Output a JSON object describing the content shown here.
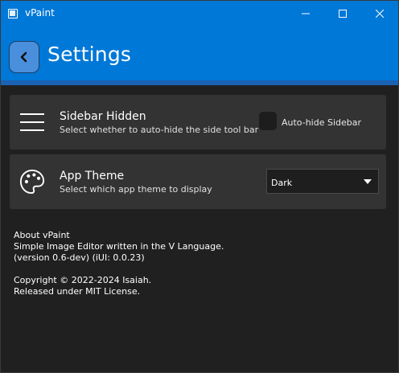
{
  "window": {
    "title": "vPaint"
  },
  "header": {
    "title": "Settings"
  },
  "settings": [
    {
      "title": "Sidebar Hidden",
      "description": "Select whether to auto-hide the side tool bar",
      "control_label": "Auto-hide Sidebar",
      "checked": false
    },
    {
      "title": "App Theme",
      "description": "Select which app theme to display",
      "selected": "Dark"
    }
  ],
  "about": {
    "heading": "About vPaint",
    "line1": "Simple Image Editor written in the V Language.",
    "line2": "(version 0.6-dev) (iUI: 0.0.23)",
    "copyright": "Copyright © 2022-2024 Isaiah.",
    "license": "Released under MIT License."
  },
  "colors": {
    "accent": "#0078d7",
    "background": "#202020",
    "card": "#333333"
  }
}
